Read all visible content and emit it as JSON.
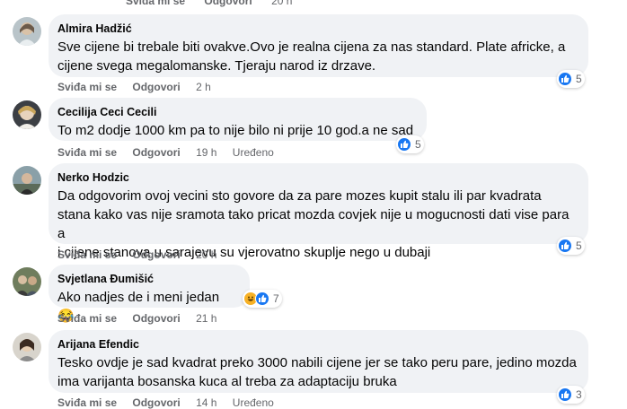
{
  "top": {
    "like_label": "Sviđa mi se",
    "reply_label": "Odgovori",
    "time": "20 h"
  },
  "comments": [
    {
      "author": "Almira Hadžić",
      "lines": [
        "Sve cijene bi trebale biti ovakve.Ovo je realna cijena za nas standard. Plate africke, a",
        "cijene svega megalomanske. Tjeraju narod iz drzave."
      ],
      "like_label": "Sviđa mi se",
      "reply_label": "Odgovori",
      "time": "2 h",
      "reaction_count": "5",
      "reactions": [
        "like-icon"
      ]
    },
    {
      "author": "Cecilija Ceci Cecili",
      "lines": [
        "To m2 dodje 1000 km pa to nije bilo ni prije 10 god.a ne sad"
      ],
      "like_label": "Sviđa mi se",
      "reply_label": "Odgovori",
      "time": "19 h",
      "edited": "Uređeno",
      "reaction_count": "5",
      "reactions": [
        "like-icon"
      ]
    },
    {
      "author": "Nerko Hodzic",
      "lines": [
        "Da odgovorim ovoj vecini sto govore da za pare mozes kupit stalu ili par kvadrata",
        "stana kako vas nije sramota tako pricat mozda covjek nije u mogucnosti dati vise para a",
        "i cijene stanova u sarajevu su vjerovatno skuplje nego u dubaji"
      ],
      "like_label": "Sviđa mi se",
      "reply_label": "Odgovori",
      "time": "20 h",
      "reaction_count": "5",
      "reactions": [
        "like-icon"
      ]
    },
    {
      "author": "Svjetlana Đumišić",
      "lines": [
        "Ako nadjes de i meni jedan 😂"
      ],
      "like_label": "Sviđa mi se",
      "reply_label": "Odgovori",
      "time": "21 h",
      "reaction_count": "7",
      "reactions": [
        "haha-icon",
        "like-icon"
      ]
    },
    {
      "author": "Arijana Efendic",
      "lines": [
        "Tesko ovdje je sad kvadrat preko 3000 nabili cijene jer se tako peru pare, jedino mozda",
        "ima varijanta bosanska kuca al treba za adaptaciju bruka"
      ],
      "like_label": "Sviđa mi se",
      "reply_label": "Odgovori",
      "time": "14 h",
      "edited": "Uređeno",
      "reaction_count": "3",
      "reactions": [
        "like-icon"
      ]
    }
  ],
  "colors": {
    "bubble": "#f0f2f5",
    "meta_text": "#65676b",
    "like_blue": "#1877f2",
    "haha_yellow": "#f7b125"
  }
}
